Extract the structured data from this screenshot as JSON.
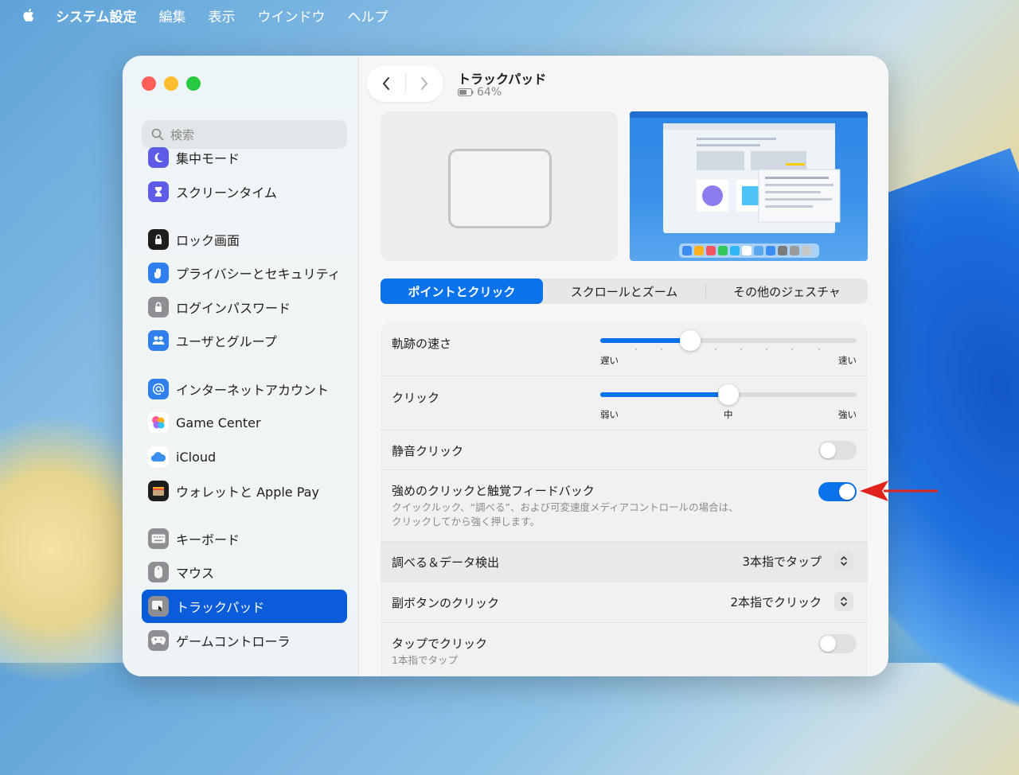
{
  "menubar": {
    "app_name": "システム設定",
    "items": [
      "編集",
      "表示",
      "ウインドウ",
      "ヘルプ"
    ]
  },
  "sidebar": {
    "search_placeholder": "検索",
    "items": [
      {
        "label": "集中モード",
        "icon": "moon-icon",
        "color": "#5e5ce6"
      },
      {
        "label": "スクリーンタイム",
        "icon": "hourglass-icon",
        "color": "#5e5ce6"
      },
      {
        "label": "ロック画面",
        "icon": "lock-screen-icon",
        "color": "#1d1d1f"
      },
      {
        "label": "プライバシーとセキュリティ",
        "icon": "hand-icon",
        "color": "#2f80ed"
      },
      {
        "label": "ログインパスワード",
        "icon": "lock-icon",
        "color": "#8e8e93"
      },
      {
        "label": "ユーザとグループ",
        "icon": "users-icon",
        "color": "#2f80ed"
      },
      {
        "label": "インターネットアカウント",
        "icon": "at-icon",
        "color": "#2f80ed"
      },
      {
        "label": "Game Center",
        "icon": "game-center-icon",
        "color": "#ffffff"
      },
      {
        "label": "iCloud",
        "icon": "cloud-icon",
        "color": "#ffffff"
      },
      {
        "label": "ウォレットと Apple Pay",
        "icon": "wallet-icon",
        "color": "#1d1d1f"
      },
      {
        "label": "キーボード",
        "icon": "keyboard-icon",
        "color": "#8e8e93"
      },
      {
        "label": "マウス",
        "icon": "mouse-icon",
        "color": "#8e8e93"
      },
      {
        "label": "トラックパッド",
        "icon": "trackpad-icon",
        "color": "#8e8e93",
        "active": true
      },
      {
        "label": "ゲームコントローラ",
        "icon": "gamepad-icon",
        "color": "#8e8e93"
      }
    ]
  },
  "header": {
    "title": "トラックパッド",
    "battery": "64%"
  },
  "tabs": [
    "ポイントとクリック",
    "スクロールとズーム",
    "その他のジェスチャ"
  ],
  "active_tab": "ポイントとクリック",
  "settings": {
    "tracking": {
      "label": "軌跡の速さ",
      "min_label": "遅い",
      "max_label": "速い",
      "value": 0.35
    },
    "click": {
      "label": "クリック",
      "min_label": "弱い",
      "mid_label": "中",
      "max_label": "強い",
      "value": 0.5
    },
    "silent_click": {
      "label": "静音クリック",
      "on": false
    },
    "force_click": {
      "label": "強めのクリックと触覚フィードバック",
      "desc1": "クイックルック、“調べる”、および可変速度メディアコントロールの場合は、",
      "desc2": "クリックしてから強く押します。",
      "on": true
    },
    "lookup": {
      "label": "調べる＆データ検出",
      "value": "3本指でタップ"
    },
    "secondary_click": {
      "label": "副ボタンのクリック",
      "value": "2本指でクリック"
    },
    "tap_to_click": {
      "label": "タップでクリック",
      "sub": "1本指でタップ",
      "on": false
    }
  },
  "colors": {
    "accent": "#0a72ea",
    "sidebar_active": "#0a5cd9",
    "annotation_arrow": "#e0241b"
  }
}
